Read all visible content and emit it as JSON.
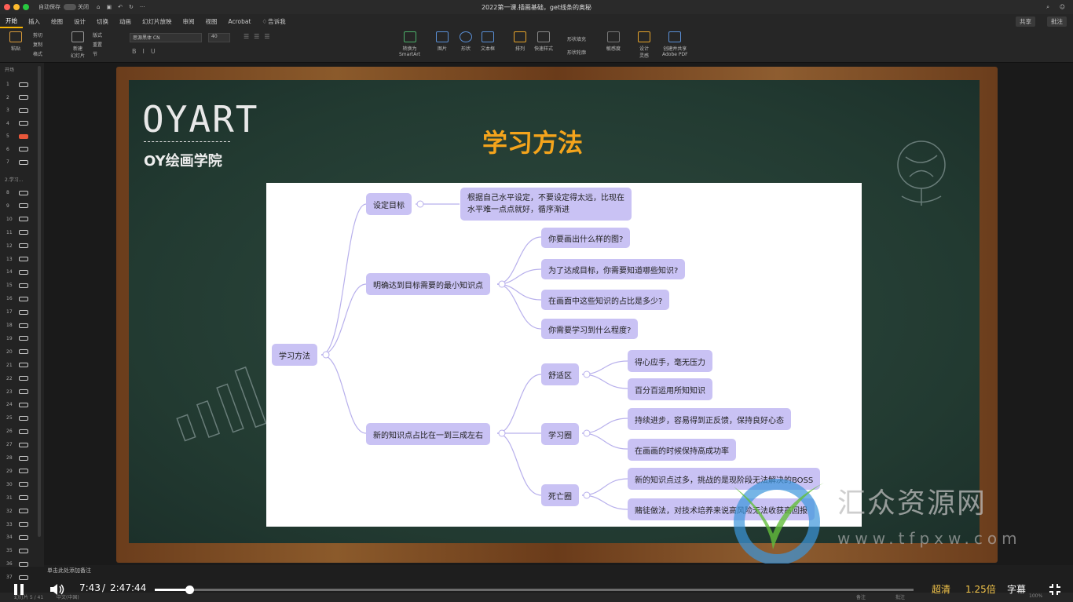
{
  "titlebar": {
    "autosave": "自动保存",
    "autosave_state": "关闭",
    "doc_title": "2022第一课.插画基础，get线条的奥秘"
  },
  "tabs": [
    "开始",
    "插入",
    "绘图",
    "设计",
    "切换",
    "动画",
    "幻灯片放映",
    "审阅",
    "视图",
    "Acrobat"
  ],
  "tell_me": "告诉我",
  "share": "共享",
  "comment": "批注",
  "ribbon": {
    "paste": "粘贴",
    "cut": "剪切",
    "copy": "复制",
    "format": "格式",
    "new_slide": "新建\n幻灯片",
    "layout": "版式",
    "reset": "重置",
    "section": "节",
    "font_name": "思源黑体 CN",
    "font_size": "40",
    "smartart": "转换为\nSmartArt",
    "picture": "图片",
    "shape": "形状",
    "textbox": "文本框",
    "arrange": "排列",
    "quick_styles": "快速样式",
    "shape_fill": "形状填充",
    "shape_outline": "形状轮廓",
    "sensitivity": "敏感度",
    "designer": "设计\n灵感",
    "adobe": "创建并共享\nAdobe PDF"
  },
  "sidebar": {
    "section1": "开场",
    "section2": "2.学习...",
    "slides": [
      "1",
      "2",
      "3",
      "4",
      "5",
      "6",
      "7",
      "8",
      "9",
      "10",
      "11",
      "12",
      "13",
      "14",
      "15",
      "16",
      "17",
      "18",
      "19",
      "20",
      "21",
      "22",
      "23",
      "24",
      "25",
      "26",
      "27",
      "28",
      "29",
      "30",
      "31",
      "32",
      "33",
      "34",
      "35",
      "36",
      "37"
    ],
    "active_slide": "5"
  },
  "slide": {
    "logo": "OYART",
    "logo_sub": "OY绘画学院",
    "title": "学习方法",
    "mindmap": {
      "root": "学习方法",
      "b1": "设定目标",
      "b1_detail": [
        "根据自己水平设定，不要设定得太远，比现在",
        "水平难一点点就好，循序渐进"
      ],
      "b2": "明确达到目标需要的最小知识点",
      "b2_items": [
        "你要画出什么样的图?",
        "为了达成目标，你需要知道哪些知识?",
        "在画面中这些知识的占比是多少?",
        "你需要学习到什么程度?"
      ],
      "b3": "新的知识点占比在一到三成左右",
      "b3_zones": [
        "舒适区",
        "学习圈",
        "死亡圈"
      ],
      "comfort": [
        "得心应手，毫无压力",
        "百分百运用所知知识"
      ],
      "learning": [
        "持续进步，容易得到正反馈，保持良好心态",
        "在画画的时候保持高成功率"
      ],
      "death": [
        "新的知识点过多，挑战的是现阶段无法解决的BOSS",
        "赌徒做法，对技术培养来说高风险无法收获高回报"
      ]
    }
  },
  "notes_placeholder": "单击此处添加备注",
  "statusbar": {
    "slide_info": "幻灯片 5 / 41",
    "lang": "中文(中国)",
    "notes": "备注",
    "comments": "批注",
    "zoom": "100%"
  },
  "player": {
    "time_current": "7:43",
    "time_sep": "/",
    "time_total": "2:47:44",
    "quality": "超清",
    "speed": "1.25倍",
    "subtitle": "字幕",
    "progress": 0.046
  },
  "watermark": {
    "text": "汇众资源网",
    "url": "www.tfpxw.com"
  },
  "colors": {
    "node": "#c9c2f4",
    "title": "#f4a41c",
    "accent": "#f8b400",
    "board": "#2a4539"
  }
}
